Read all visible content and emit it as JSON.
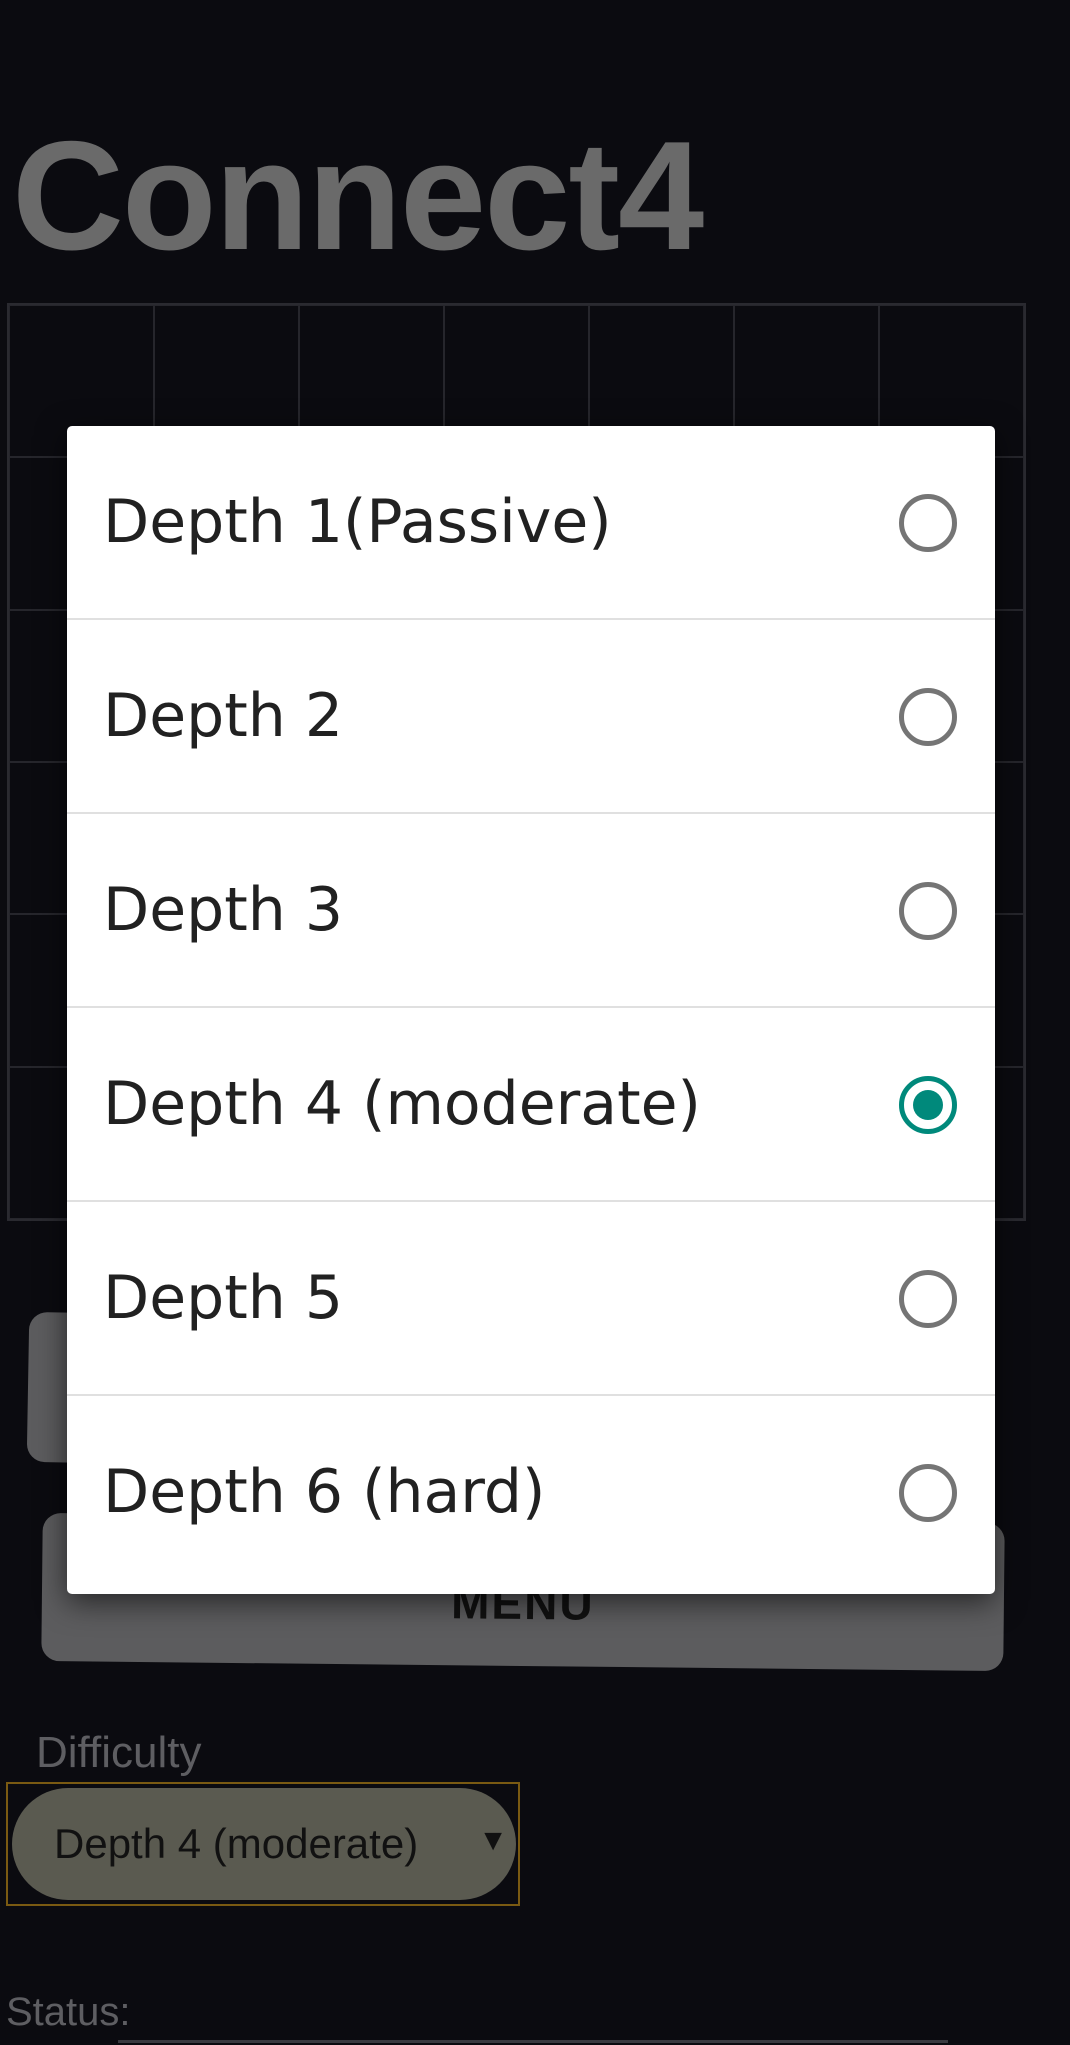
{
  "app": {
    "title": "Connect4",
    "menu_button_label": "MENU",
    "difficulty_label": "Difficulty",
    "difficulty_selected": "Depth 4 (moderate)",
    "status_label": "Status:"
  },
  "dialog": {
    "options": [
      {
        "label": "Depth 1(Passive)",
        "checked": false
      },
      {
        "label": "Depth 2",
        "checked": false
      },
      {
        "label": "Depth 3",
        "checked": false
      },
      {
        "label": "Depth 4 (moderate)",
        "checked": true
      },
      {
        "label": "Depth 5",
        "checked": false
      },
      {
        "label": "Depth 6 (hard)",
        "checked": false
      }
    ],
    "accent_color": "#00897b"
  }
}
